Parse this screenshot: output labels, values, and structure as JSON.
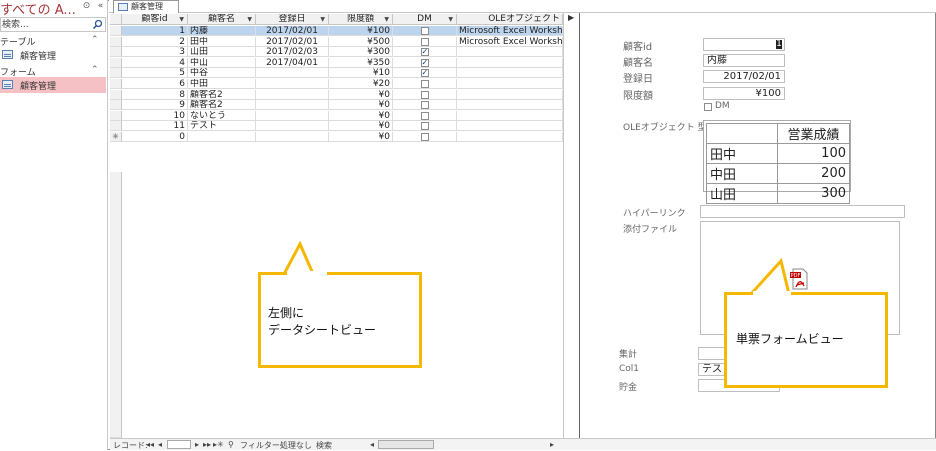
{
  "nav": {
    "title": "すべての A...",
    "search_placeholder": "検索...",
    "groups": [
      {
        "label": "テーブル",
        "items": [
          {
            "label": "顧客管理"
          }
        ]
      },
      {
        "label": "フォーム",
        "items": [
          {
            "label": "顧客管理"
          }
        ]
      }
    ],
    "collapse_glyph": "«",
    "dropdown_glyph": "⊙",
    "group_chevron": "⌃"
  },
  "tab": {
    "label": "顧客管理"
  },
  "datasheet": {
    "columns": [
      "顧客id",
      "顧客名",
      "登録日",
      "限度額",
      "DM",
      "OLEオブジェクト"
    ],
    "rows": [
      {
        "id": "1",
        "name": "内藤",
        "date": "2017/02/01",
        "limit": "¥100",
        "dm": false,
        "ole": "Microsoft Excel Worksh",
        "selected": true
      },
      {
        "id": "2",
        "name": "田中",
        "date": "2017/02/01",
        "limit": "¥500",
        "dm": false,
        "ole": "Microsoft Excel Worksh",
        "selected": false
      },
      {
        "id": "3",
        "name": "山田",
        "date": "2017/02/03",
        "limit": "¥300",
        "dm": true,
        "ole": "",
        "selected": false
      },
      {
        "id": "4",
        "name": "中山",
        "date": "2017/04/01",
        "limit": "¥350",
        "dm": true,
        "ole": "",
        "selected": false
      },
      {
        "id": "5",
        "name": "中谷",
        "date": "",
        "limit": "¥10",
        "dm": true,
        "ole": "",
        "selected": false
      },
      {
        "id": "6",
        "name": "中田",
        "date": "",
        "limit": "¥20",
        "dm": false,
        "ole": "",
        "selected": false
      },
      {
        "id": "8",
        "name": "顧客名2",
        "date": "",
        "limit": "¥0",
        "dm": false,
        "ole": "",
        "selected": false
      },
      {
        "id": "9",
        "name": "顧客名2",
        "date": "",
        "limit": "¥0",
        "dm": false,
        "ole": "",
        "selected": false
      },
      {
        "id": "10",
        "name": "ないとう",
        "date": "",
        "limit": "¥0",
        "dm": false,
        "ole": "",
        "selected": false
      },
      {
        "id": "11",
        "name": "テスト",
        "date": "",
        "limit": "¥0",
        "dm": false,
        "ole": "",
        "selected": false
      },
      {
        "id": "0",
        "name": "",
        "date": "",
        "limit": "¥0",
        "dm": false,
        "ole": "",
        "selected": false,
        "new": true
      }
    ],
    "new_row_marker": "✳"
  },
  "navbar": {
    "record_label": "レコード: ",
    "first": "◂◂",
    "prev": "◂",
    "next": "▸",
    "last": "▸▸",
    "new": "▸✳",
    "filter": "フィルター処理なし",
    "search": "検索"
  },
  "form": {
    "fields": [
      {
        "label": "顧客id",
        "value": "1"
      },
      {
        "label": "顧客名",
        "value": "内藤"
      },
      {
        "label": "登録日",
        "value": "2017/02/01"
      },
      {
        "label": "限度額",
        "value": "¥100"
      }
    ],
    "dm_label": "DM",
    "ole_label": "OLEオブジェクト 型",
    "ole_table": {
      "header": [
        "",
        "営業成績"
      ],
      "rows": [
        [
          "田中",
          "100"
        ],
        [
          "中田",
          "200"
        ],
        [
          "山田",
          "300"
        ]
      ]
    },
    "hyperlink_label": "ハイパーリンク",
    "attachment_label": "添付ファイル",
    "total_label": "集計",
    "col1_label": "Col1",
    "col1_value": "テスト",
    "savings_label": "貯金"
  },
  "callouts": {
    "left_line1": "左側に",
    "left_line2": "データシートビュー",
    "right": "単票フォームビュー"
  },
  "colors": {
    "callout_border": "#f5b700",
    "nav_title": "#a4373a",
    "nav_selected": "#f6c1c4",
    "row_selected": "#bcd4ee"
  }
}
